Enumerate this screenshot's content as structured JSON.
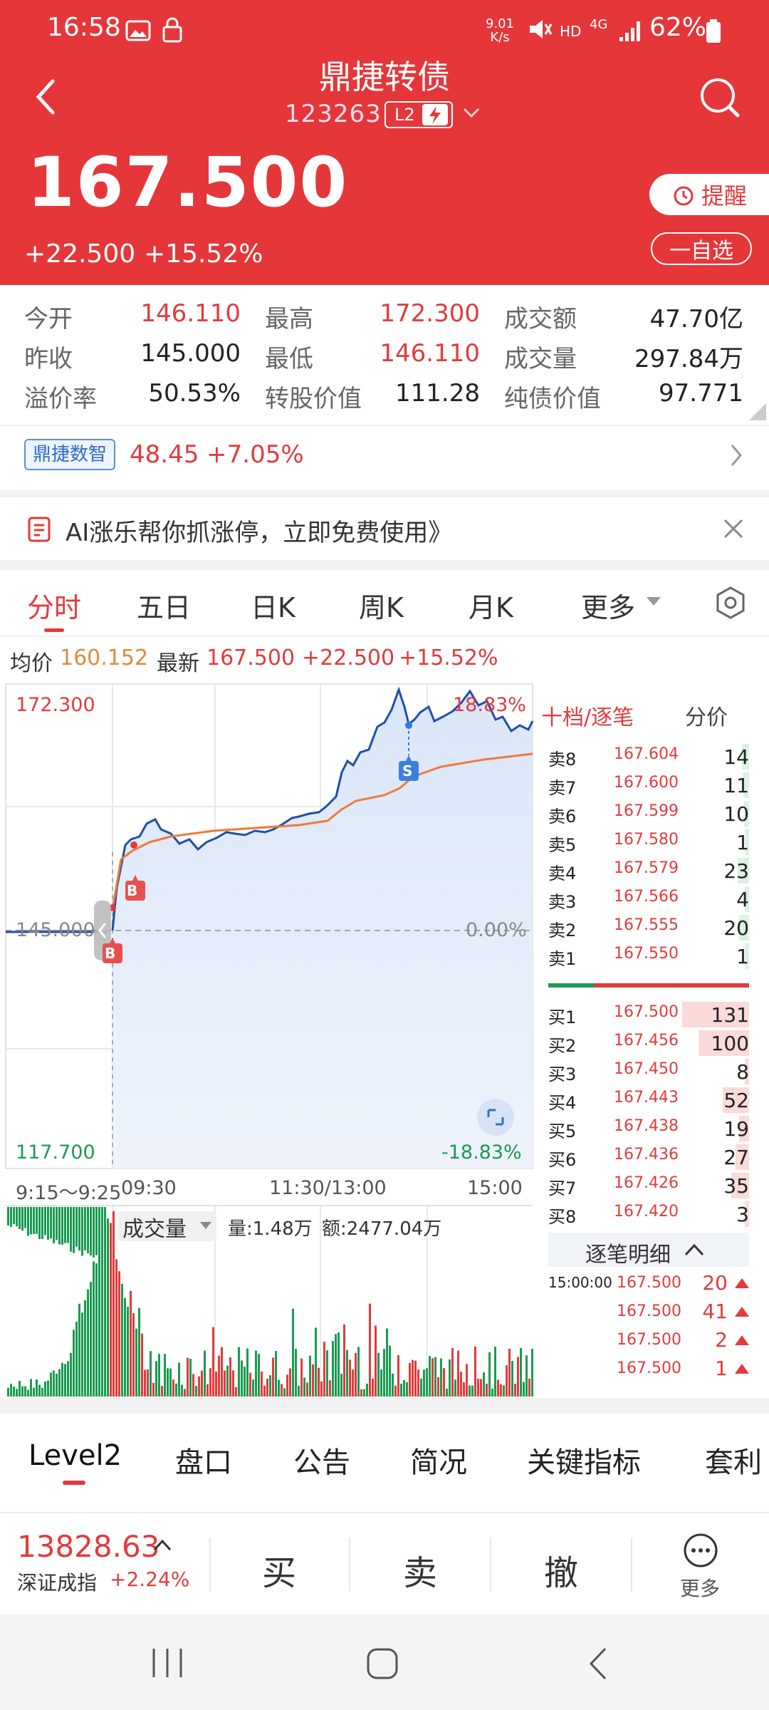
{
  "status": {
    "time": "16:58",
    "speed": "9.01\nK/s",
    "hd": "HD",
    "net": "4G",
    "battery": "62%"
  },
  "header": {
    "title": "鼎捷转债",
    "code": "123263",
    "badge": "L2"
  },
  "quote": {
    "price": "167.500",
    "change": "+22.500",
    "pct": "+15.52%",
    "remind_label": "提醒",
    "fav_label": "一自选"
  },
  "stats": [
    {
      "label": "今开",
      "value": "146.110",
      "red": true
    },
    {
      "label": "最高",
      "value": "172.300",
      "red": true
    },
    {
      "label": "成交额",
      "value": "47.70亿",
      "red": false
    },
    {
      "label": "昨收",
      "value": "145.000",
      "red": false
    },
    {
      "label": "最低",
      "value": "146.110",
      "red": true
    },
    {
      "label": "成交量",
      "value": "297.84万",
      "red": false
    },
    {
      "label": "溢价率",
      "value": "50.53%",
      "red": false
    },
    {
      "label": "转股价值",
      "value": "111.28",
      "red": false
    },
    {
      "label": "纯债价值",
      "value": "97.771",
      "red": false
    }
  ],
  "smart": {
    "tag": "鼎捷数智",
    "value": "48.45 +7.05%"
  },
  "ad": {
    "text": "AI涨乐帮你抓涨停，立即免费使用》"
  },
  "tabs": [
    "分时",
    "五日",
    "日K",
    "周K",
    "月K",
    "更多"
  ],
  "infoline": {
    "avg_label": "均价",
    "avg": "160.152",
    "latest_label": "最新",
    "latest": "167.500",
    "change": "+22.500",
    "pct": "+15.52%"
  },
  "chart": {
    "y_top": "172.300",
    "y_mid": "145.000",
    "y_bot": "117.700",
    "pct_top": "18.83%",
    "pct_mid": "0.00%",
    "pct_bot": "-18.83%",
    "x_labels": [
      "9:15～9:25",
      "09:30",
      "11:30/13:00",
      "15:00"
    ],
    "marker_b": "B",
    "marker_s": "S",
    "vol_label": "成交量",
    "vol_amount": "量:1.48万",
    "vol_value": "额:2477.04万"
  },
  "orderbook": {
    "tab1": "十档/逐笔",
    "tab2": "分价",
    "asks": [
      {
        "label": "卖8",
        "price": "167.604",
        "qty": "14"
      },
      {
        "label": "卖7",
        "price": "167.600",
        "qty": "11"
      },
      {
        "label": "卖6",
        "price": "167.599",
        "qty": "10"
      },
      {
        "label": "卖5",
        "price": "167.580",
        "qty": "1"
      },
      {
        "label": "卖4",
        "price": "167.579",
        "qty": "23"
      },
      {
        "label": "卖3",
        "price": "167.566",
        "qty": "4"
      },
      {
        "label": "卖2",
        "price": "167.555",
        "qty": "20"
      },
      {
        "label": "卖1",
        "price": "167.550",
        "qty": "1"
      }
    ],
    "bids": [
      {
        "label": "买1",
        "price": "167.500",
        "qty": "131"
      },
      {
        "label": "买2",
        "price": "167.456",
        "qty": "100"
      },
      {
        "label": "买3",
        "price": "167.450",
        "qty": "8"
      },
      {
        "label": "买4",
        "price": "167.443",
        "qty": "52"
      },
      {
        "label": "买5",
        "price": "167.438",
        "qty": "19"
      },
      {
        "label": "买6",
        "price": "167.436",
        "qty": "27"
      },
      {
        "label": "买7",
        "price": "167.426",
        "qty": "35"
      },
      {
        "label": "买8",
        "price": "167.420",
        "qty": "3"
      }
    ],
    "ticks_label": "逐笔明细",
    "ticks": [
      {
        "time": "15:00:00",
        "price": "167.500",
        "qty": "20"
      },
      {
        "time": "",
        "price": "167.500",
        "qty": "41"
      },
      {
        "time": "",
        "price": "167.500",
        "qty": "2"
      },
      {
        "time": "",
        "price": "167.500",
        "qty": "1"
      }
    ]
  },
  "bottom_tabs": [
    "Level2",
    "盘口",
    "公告",
    "简况",
    "关键指标",
    "套利"
  ],
  "index": {
    "value": "13828.63",
    "name": "深证成指",
    "pct": "+2.24%"
  },
  "trade": {
    "buy": "买",
    "sell": "卖",
    "cancel": "撤",
    "more": "更多"
  }
}
